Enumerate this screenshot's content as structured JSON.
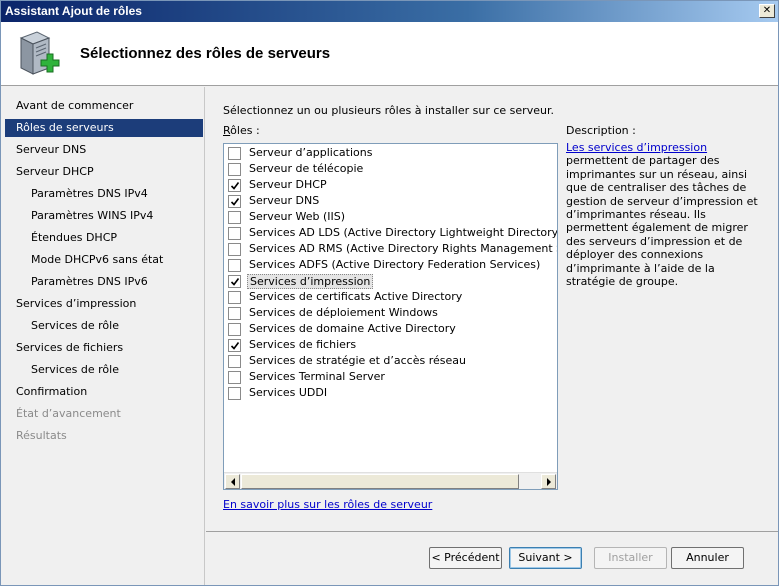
{
  "window": {
    "title": "Assistant Ajout de rôles",
    "close_glyph": "✕"
  },
  "header": {
    "title": "Sélectionnez des rôles de serveurs",
    "icon": "server-add-icon"
  },
  "nav": {
    "items": [
      {
        "label": "Avant de commencer",
        "level": 0,
        "state": "normal"
      },
      {
        "label": "Rôles de serveurs",
        "level": 0,
        "state": "active"
      },
      {
        "label": "Serveur DNS",
        "level": 0,
        "state": "normal"
      },
      {
        "label": "Serveur DHCP",
        "level": 0,
        "state": "normal"
      },
      {
        "label": "Paramètres DNS IPv4",
        "level": 1,
        "state": "normal"
      },
      {
        "label": "Paramètres WINS IPv4",
        "level": 1,
        "state": "normal"
      },
      {
        "label": "Étendues DHCP",
        "level": 1,
        "state": "normal"
      },
      {
        "label": "Mode DHCPv6 sans état",
        "level": 1,
        "state": "normal"
      },
      {
        "label": "Paramètres DNS IPv6",
        "level": 1,
        "state": "normal"
      },
      {
        "label": "Services d’impression",
        "level": 0,
        "state": "normal"
      },
      {
        "label": "Services de rôle",
        "level": 1,
        "state": "normal"
      },
      {
        "label": "Services de fichiers",
        "level": 0,
        "state": "normal"
      },
      {
        "label": "Services de rôle",
        "level": 1,
        "state": "normal"
      },
      {
        "label": "Confirmation",
        "level": 0,
        "state": "normal"
      },
      {
        "label": "État d’avancement",
        "level": 0,
        "state": "disabled"
      },
      {
        "label": "Résultats",
        "level": 0,
        "state": "disabled"
      }
    ]
  },
  "main": {
    "instruction": "Sélectionnez un ou plusieurs rôles à installer sur ce serveur.",
    "roles_label_access": "R",
    "roles_label_rest": "ôles :",
    "roles": [
      {
        "label": "Serveur d’applications",
        "checked": false
      },
      {
        "label": "Serveur de télécopie",
        "checked": false
      },
      {
        "label": "Serveur DHCP",
        "checked": true
      },
      {
        "label": "Serveur DNS",
        "checked": true
      },
      {
        "label": "Serveur Web (IIS)",
        "checked": false
      },
      {
        "label": "Services AD LDS (Active Directory Lightweight Directory Services)",
        "checked": false
      },
      {
        "label": "Services AD RMS (Active Directory Rights Management Services)",
        "checked": false
      },
      {
        "label": "Services ADFS (Active Directory Federation Services)",
        "checked": false
      },
      {
        "label": "Services d’impression",
        "checked": true,
        "selected": true
      },
      {
        "label": "Services de certificats Active Directory",
        "checked": false
      },
      {
        "label": "Services de déploiement Windows",
        "checked": false
      },
      {
        "label": "Services de domaine Active Directory",
        "checked": false
      },
      {
        "label": "Services de fichiers",
        "checked": true
      },
      {
        "label": "Services de stratégie et d’accès réseau",
        "checked": false
      },
      {
        "label": "Services Terminal Server",
        "checked": false
      },
      {
        "label": "Services UDDI",
        "checked": false
      }
    ],
    "description_label": "Description :",
    "description_link": "Les services d’impression",
    "description_text": " permettent de partager des imprimantes sur un réseau, ainsi que de centraliser des tâches de gestion de serveur d’impression et d’imprimantes réseau. Ils permettent également de migrer des serveurs d’impression et de déployer des connexions d’imprimante à l’aide de la stratégie de groupe.",
    "learn_more": "En savoir plus sur les rôles de serveur"
  },
  "footer": {
    "previous": "< Précédent",
    "next": "Suivant >",
    "install": "Installer",
    "cancel": "Annuler"
  }
}
